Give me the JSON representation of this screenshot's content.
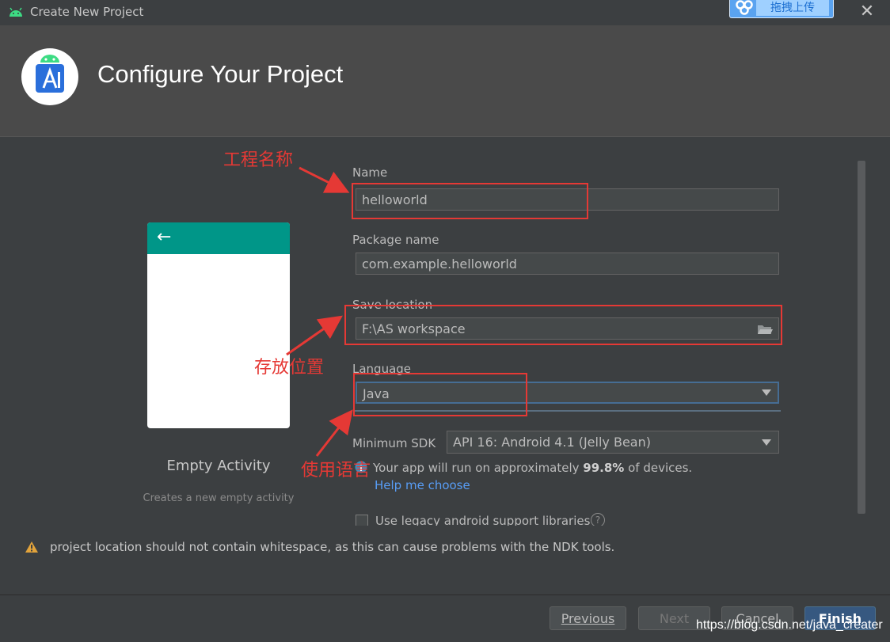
{
  "window": {
    "title": "Create New Project",
    "close_glyph": "✕",
    "upload_button": "拖拽上传"
  },
  "header": {
    "title": "Configure Your Project"
  },
  "template": {
    "back_glyph": "←",
    "name": "Empty Activity",
    "description": "Creates a new empty activity"
  },
  "form": {
    "name_label": "Name",
    "name_value": "helloworld",
    "package_label": "Package name",
    "package_value": "com.example.helloworld",
    "location_label": "Save location",
    "location_value": "F:\\AS workspace",
    "language_label": "Language",
    "language_value": "Java",
    "min_sdk_label": "Minimum SDK",
    "min_sdk_value": "API 16: Android 4.1 (Jelly Bean)",
    "info_prefix": "Your app will run on approximately ",
    "info_percent": "99.8%",
    "info_suffix": " of devices.",
    "help_link": "Help me choose",
    "legacy_label": "Use legacy android support libraries",
    "legacy_checked": false
  },
  "annotations": {
    "project_name": "工程名称",
    "save_location": "存放位置",
    "language": "使用语言"
  },
  "warning": {
    "text": "project location should not contain whitespace, as this can cause problems with the NDK tools."
  },
  "footer": {
    "previous": "Previous",
    "next": "Next",
    "cancel": "Cancel",
    "finish": "Finish"
  },
  "watermark": "https://blog.csdn.net/java_creater",
  "colors": {
    "accent_teal": "#009688",
    "annotation_red": "#e53935",
    "link_blue": "#589df6",
    "primary_button": "#365880"
  }
}
